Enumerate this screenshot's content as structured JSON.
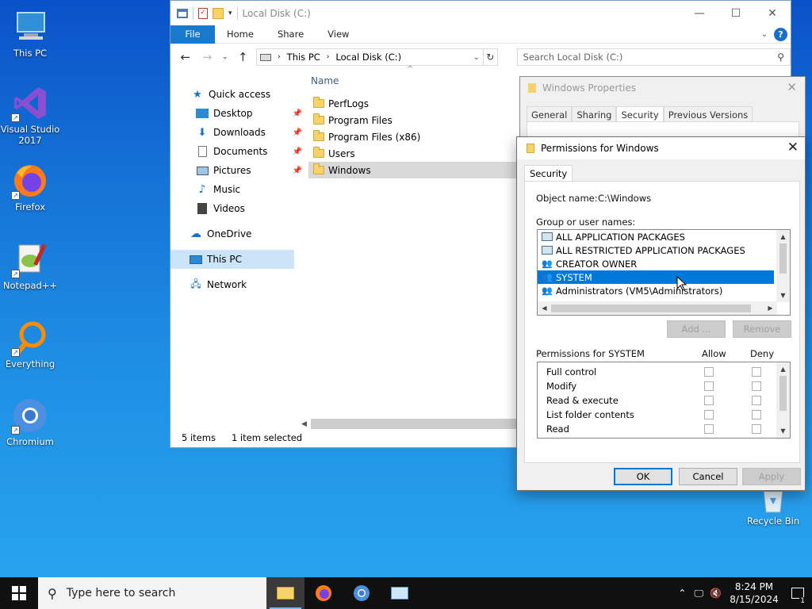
{
  "desktop_icons": [
    {
      "label": "This PC",
      "icon": "this-pc-icon"
    },
    {
      "label": "Visual Studio 2017",
      "icon": "visual-studio-icon"
    },
    {
      "label": "Firefox",
      "icon": "firefox-icon"
    },
    {
      "label": "Notepad++",
      "icon": "notepadpp-icon"
    },
    {
      "label": "Everything",
      "icon": "everything-icon"
    },
    {
      "label": "Chromium",
      "icon": "chromium-icon"
    },
    {
      "label": "Recycle Bin",
      "icon": "recycle-bin-icon"
    }
  ],
  "explorer": {
    "title": "Local Disk (C:)",
    "ribbon_tabs": [
      "File",
      "Home",
      "Share",
      "View"
    ],
    "breadcrumb": [
      "This PC",
      "Local Disk (C:)"
    ],
    "search_placeholder": "Search Local Disk (C:)",
    "nav": {
      "quick_access": "Quick access",
      "items": [
        "Desktop",
        "Downloads",
        "Documents",
        "Pictures",
        "Music",
        "Videos"
      ],
      "onedrive": "OneDrive",
      "this_pc": "This PC",
      "network": "Network"
    },
    "column_name": "Name",
    "files": [
      "PerfLogs",
      "Program Files",
      "Program Files (x86)",
      "Users",
      "Windows"
    ],
    "selected_file": "Windows",
    "status_items": "5 items",
    "status_selected": "1 item selected"
  },
  "properties": {
    "title": "Windows Properties",
    "tabs": [
      "General",
      "Sharing",
      "Security",
      "Previous Versions"
    ],
    "active_tab": "Security"
  },
  "permissions": {
    "title": "Permissions for Windows",
    "tab": "Security",
    "object_label": "Object name:",
    "object_value": "C:\\Windows",
    "group_label": "Group or user names:",
    "groups": [
      "ALL APPLICATION PACKAGES",
      "ALL RESTRICTED APPLICATION PACKAGES",
      "CREATOR OWNER",
      "SYSTEM",
      "Administrators (VM5\\Administrators)"
    ],
    "selected_group": "SYSTEM",
    "add_label": "Add ...",
    "remove_label": "Remove",
    "perm_header": "Permissions for SYSTEM",
    "allow_label": "Allow",
    "deny_label": "Deny",
    "perms": [
      "Full control",
      "Modify",
      "Read & execute",
      "List folder contents",
      "Read"
    ],
    "ok": "OK",
    "cancel": "Cancel",
    "apply": "Apply"
  },
  "taskbar": {
    "search_placeholder": "Type here to search",
    "time": "8:24 PM",
    "date": "8/15/2024",
    "notification_count": "1"
  },
  "colors": {
    "accent": "#0078d7",
    "selection": "#cce4f7"
  }
}
